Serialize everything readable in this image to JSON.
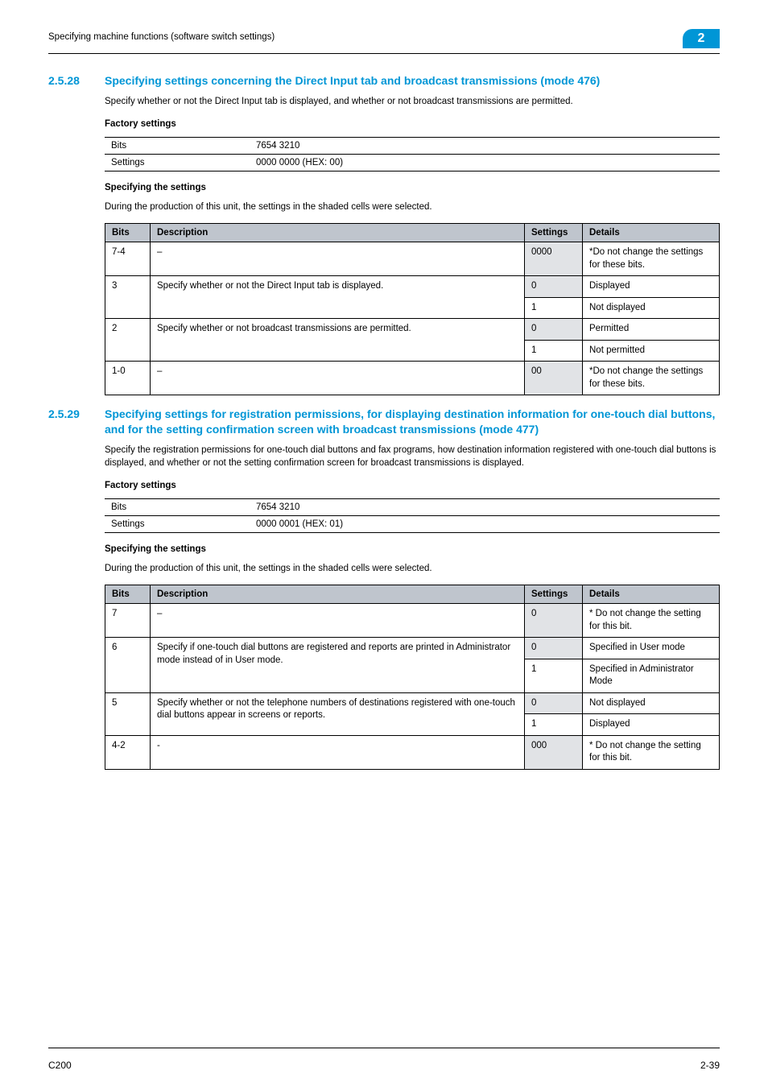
{
  "header": {
    "running_title": "Specifying machine functions (software switch settings)",
    "chapter_number": "2"
  },
  "sections": [
    {
      "number": "2.5.28",
      "title": "Specifying settings concerning the Direct Input tab and broadcast transmissions (mode 476)",
      "intro": "Specify whether or not the Direct Input tab is displayed, and whether or not broadcast transmissions are permitted.",
      "factory_label": "Factory settings",
      "factory_table": {
        "rows": [
          {
            "k": "Bits",
            "v": "7654 3210"
          },
          {
            "k": "Settings",
            "v": "0000 0000 (HEX: 00)"
          }
        ]
      },
      "spec_label": "Specifying the settings",
      "spec_intro": "During the production of this unit, the settings in the shaded cells were selected.",
      "spec_table": {
        "headers": {
          "bits": "Bits",
          "description": "Description",
          "settings": "Settings",
          "details": "Details"
        },
        "rows": [
          {
            "bits": "7-4",
            "desc": "–",
            "settings": "0000",
            "details": "*Do not change the settings for these bits.",
            "shaded": true,
            "first_of_group": true,
            "rowspan_bits": 1,
            "rowspan_desc": 1
          },
          {
            "bits": "3",
            "desc": "Specify whether or not the Direct Input tab is displayed.",
            "settings": "0",
            "details": "Displayed",
            "shaded": true,
            "first_of_group": true,
            "rowspan_bits": 2,
            "rowspan_desc": 2
          },
          {
            "settings": "1",
            "details": "Not displayed",
            "shaded": false,
            "first_of_group": false
          },
          {
            "bits": "2",
            "desc": "Specify whether or not broadcast transmissions are permitted.",
            "settings": "0",
            "details": "Permitted",
            "shaded": true,
            "first_of_group": true,
            "rowspan_bits": 2,
            "rowspan_desc": 2
          },
          {
            "settings": "1",
            "details": "Not permitted",
            "shaded": false,
            "first_of_group": false
          },
          {
            "bits": "1-0",
            "desc": "–",
            "settings": "00",
            "details": "*Do not change the settings for these bits.",
            "shaded": true,
            "first_of_group": true,
            "rowspan_bits": 1,
            "rowspan_desc": 1
          }
        ]
      }
    },
    {
      "number": "2.5.29",
      "title": "Specifying settings for registration permissions, for displaying destination information for one-touch dial buttons, and for the setting confirmation screen with broadcast transmissions (mode 477)",
      "intro": "Specify the registration permissions for one-touch dial buttons and fax programs, how destination information registered with one-touch dial buttons is displayed, and whether or not the setting confirmation screen for broadcast transmissions is displayed.",
      "factory_label": "Factory settings",
      "factory_table": {
        "rows": [
          {
            "k": "Bits",
            "v": "7654 3210"
          },
          {
            "k": "Settings",
            "v": "0000 0001 (HEX: 01)"
          }
        ]
      },
      "spec_label": "Specifying the settings",
      "spec_intro": "During the production of this unit, the settings in the shaded cells were selected.",
      "spec_table": {
        "headers": {
          "bits": "Bits",
          "description": "Description",
          "settings": "Settings",
          "details": "Details"
        },
        "rows": [
          {
            "bits": "7",
            "desc": "–",
            "settings": "0",
            "details": "* Do not change the setting for this bit.",
            "shaded": true,
            "first_of_group": true,
            "rowspan_bits": 1,
            "rowspan_desc": 1
          },
          {
            "bits": "6",
            "desc": "Specify if one-touch dial buttons are registered and reports are printed in Administrator mode instead of in User mode.",
            "settings": "0",
            "details": "Specified in User mode",
            "shaded": true,
            "first_of_group": true,
            "rowspan_bits": 2,
            "rowspan_desc": 2
          },
          {
            "settings": "1",
            "details": "Specified in Administrator Mode",
            "shaded": false,
            "first_of_group": false
          },
          {
            "bits": "5",
            "desc": "Specify whether or not the telephone numbers of destinations registered with one-touch dial buttons appear in screens or reports.",
            "settings": "0",
            "details": "Not displayed",
            "shaded": true,
            "first_of_group": true,
            "rowspan_bits": 2,
            "rowspan_desc": 2
          },
          {
            "settings": "1",
            "details": "Displayed",
            "shaded": false,
            "first_of_group": false
          },
          {
            "bits": "4-2",
            "desc": "-",
            "settings": "000",
            "details": "* Do not change the setting for this bit.",
            "shaded": true,
            "first_of_group": true,
            "rowspan_bits": 1,
            "rowspan_desc": 1
          }
        ]
      }
    }
  ],
  "footer": {
    "left": "C200",
    "right": "2-39"
  }
}
